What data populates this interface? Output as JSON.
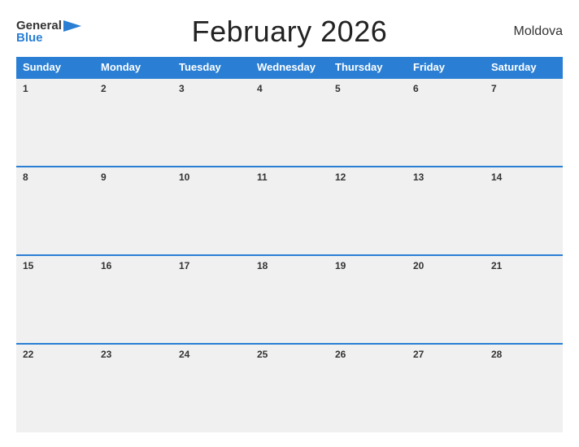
{
  "header": {
    "logo_general": "General",
    "logo_blue": "Blue",
    "title": "February 2026",
    "country": "Moldova"
  },
  "calendar": {
    "days_of_week": [
      "Sunday",
      "Monday",
      "Tuesday",
      "Wednesday",
      "Thursday",
      "Friday",
      "Saturday"
    ],
    "weeks": [
      [
        1,
        2,
        3,
        4,
        5,
        6,
        7
      ],
      [
        8,
        9,
        10,
        11,
        12,
        13,
        14
      ],
      [
        15,
        16,
        17,
        18,
        19,
        20,
        21
      ],
      [
        22,
        23,
        24,
        25,
        26,
        27,
        28
      ]
    ]
  }
}
